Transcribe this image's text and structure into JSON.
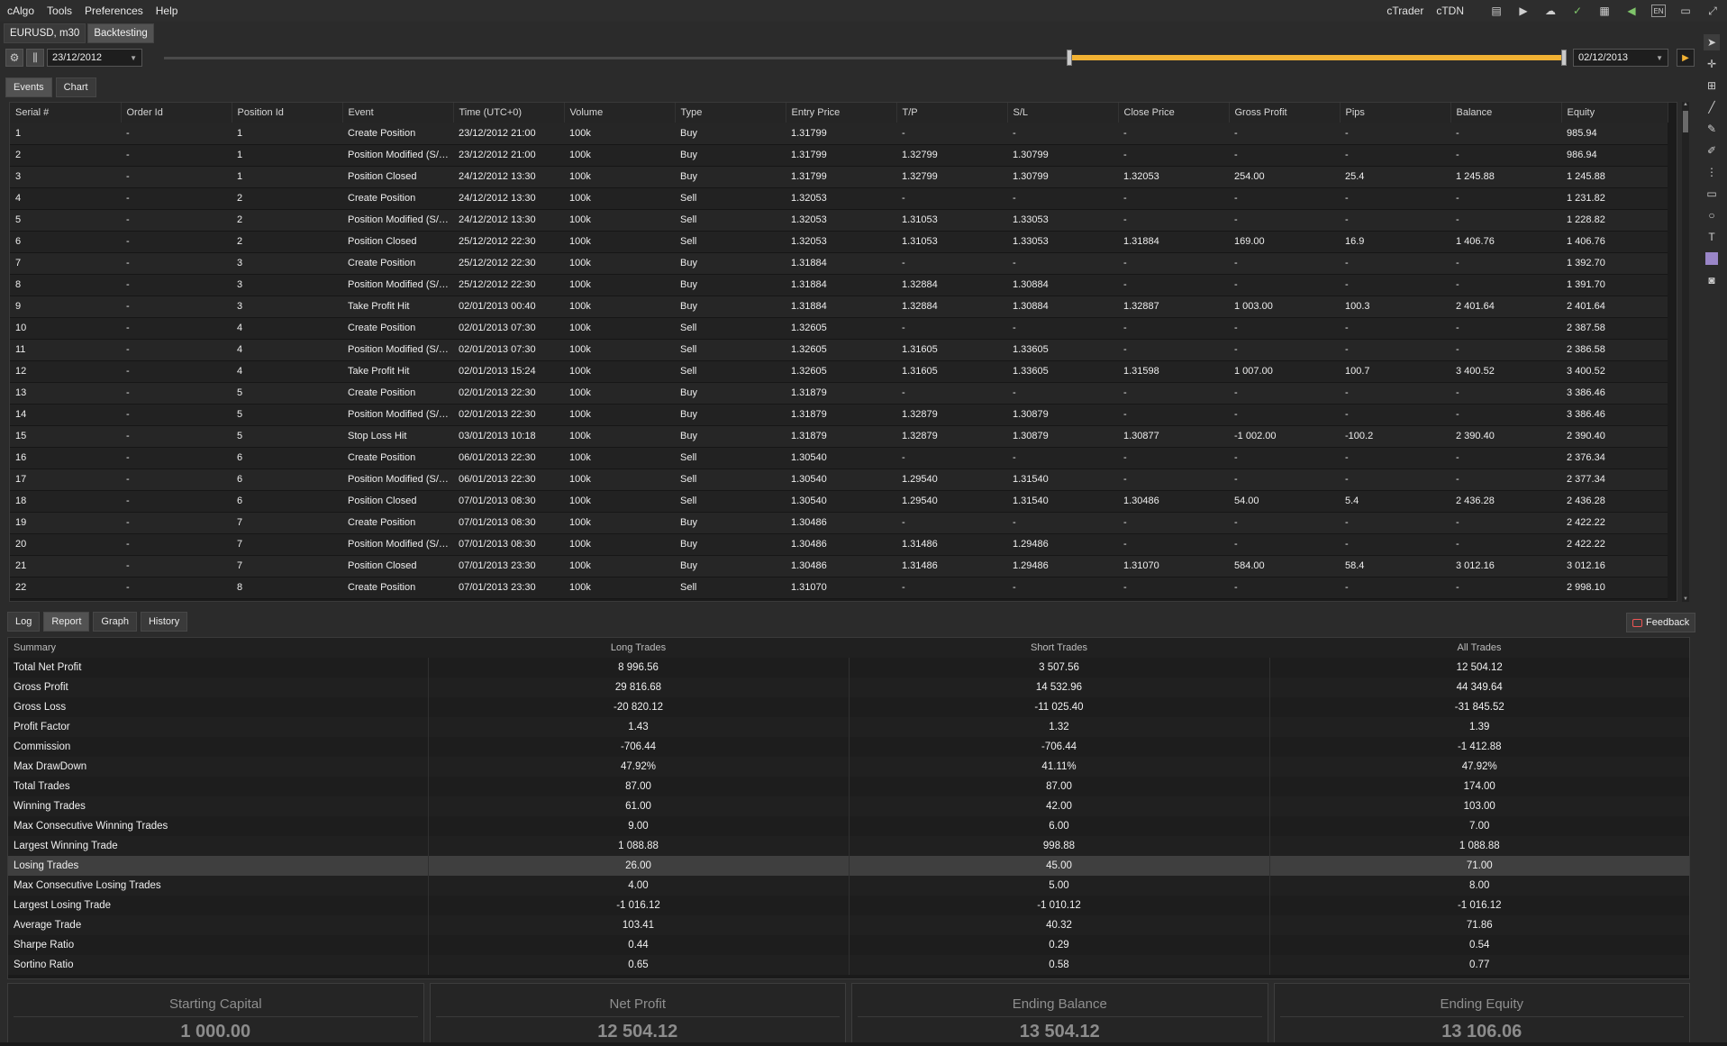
{
  "menubar": {
    "items": [
      "cAlgo",
      "Tools",
      "Preferences",
      "Help"
    ],
    "right_links": [
      "cTrader",
      "cTDN"
    ],
    "icons": [
      "notes-icon",
      "video-icon",
      "cloud-icon",
      "sync-icon",
      "calendar-icon",
      "volume-icon",
      "language-icon",
      "window-icon",
      "restore-icon"
    ],
    "lang": "EN"
  },
  "doc_tabs": [
    "EURUSD, m30",
    "Backtesting"
  ],
  "toolbar": {
    "start_date": "23/12/2012",
    "end_date": "02/12/2013",
    "period_progress": 0.35
  },
  "event_tabs": [
    "Events",
    "Chart"
  ],
  "events": {
    "columns": [
      "Serial #",
      "Order Id",
      "Position Id",
      "Event",
      "Time (UTC+0)",
      "Volume",
      "Type",
      "Entry Price",
      "T/P",
      "S/L",
      "Close Price",
      "Gross Profit",
      "Pips",
      "Balance",
      "Equity"
    ],
    "rows": [
      [
        "1",
        "-",
        "1",
        "Create Position",
        "23/12/2012 21:00",
        "100k",
        "Buy",
        "1.31799",
        "-",
        "-",
        "-",
        "-",
        "-",
        "-",
        "985.94"
      ],
      [
        "2",
        "-",
        "1",
        "Position Modified (S/L, T/P)",
        "23/12/2012 21:00",
        "100k",
        "Buy",
        "1.31799",
        "1.32799",
        "1.30799",
        "-",
        "-",
        "-",
        "-",
        "986.94"
      ],
      [
        "3",
        "-",
        "1",
        "Position Closed",
        "24/12/2012 13:30",
        "100k",
        "Buy",
        "1.31799",
        "1.32799",
        "1.30799",
        "1.32053",
        "254.00",
        "25.4",
        "1 245.88",
        "1 245.88"
      ],
      [
        "4",
        "-",
        "2",
        "Create Position",
        "24/12/2012 13:30",
        "100k",
        "Sell",
        "1.32053",
        "-",
        "-",
        "-",
        "-",
        "-",
        "-",
        "1 231.82"
      ],
      [
        "5",
        "-",
        "2",
        "Position Modified (S/L, T/P)",
        "24/12/2012 13:30",
        "100k",
        "Sell",
        "1.32053",
        "1.31053",
        "1.33053",
        "-",
        "-",
        "-",
        "-",
        "1 228.82"
      ],
      [
        "6",
        "-",
        "2",
        "Position Closed",
        "25/12/2012 22:30",
        "100k",
        "Sell",
        "1.32053",
        "1.31053",
        "1.33053",
        "1.31884",
        "169.00",
        "16.9",
        "1 406.76",
        "1 406.76"
      ],
      [
        "7",
        "-",
        "3",
        "Create Position",
        "25/12/2012 22:30",
        "100k",
        "Buy",
        "1.31884",
        "-",
        "-",
        "-",
        "-",
        "-",
        "-",
        "1 392.70"
      ],
      [
        "8",
        "-",
        "3",
        "Position Modified (S/L, T/P)",
        "25/12/2012 22:30",
        "100k",
        "Buy",
        "1.31884",
        "1.32884",
        "1.30884",
        "-",
        "-",
        "-",
        "-",
        "1 391.70"
      ],
      [
        "9",
        "-",
        "3",
        "Take Profit Hit",
        "02/01/2013 00:40",
        "100k",
        "Buy",
        "1.31884",
        "1.32884",
        "1.30884",
        "1.32887",
        "1 003.00",
        "100.3",
        "2 401.64",
        "2 401.64"
      ],
      [
        "10",
        "-",
        "4",
        "Create Position",
        "02/01/2013 07:30",
        "100k",
        "Sell",
        "1.32605",
        "-",
        "-",
        "-",
        "-",
        "-",
        "-",
        "2 387.58"
      ],
      [
        "11",
        "-",
        "4",
        "Position Modified (S/L, T/P)",
        "02/01/2013 07:30",
        "100k",
        "Sell",
        "1.32605",
        "1.31605",
        "1.33605",
        "-",
        "-",
        "-",
        "-",
        "2 386.58"
      ],
      [
        "12",
        "-",
        "4",
        "Take Profit Hit",
        "02/01/2013 15:24",
        "100k",
        "Sell",
        "1.32605",
        "1.31605",
        "1.33605",
        "1.31598",
        "1 007.00",
        "100.7",
        "3 400.52",
        "3 400.52"
      ],
      [
        "13",
        "-",
        "5",
        "Create Position",
        "02/01/2013 22:30",
        "100k",
        "Buy",
        "1.31879",
        "-",
        "-",
        "-",
        "-",
        "-",
        "-",
        "3 386.46"
      ],
      [
        "14",
        "-",
        "5",
        "Position Modified (S/L, T/P)",
        "02/01/2013 22:30",
        "100k",
        "Buy",
        "1.31879",
        "1.32879",
        "1.30879",
        "-",
        "-",
        "-",
        "-",
        "3 386.46"
      ],
      [
        "15",
        "-",
        "5",
        "Stop Loss Hit",
        "03/01/2013 10:18",
        "100k",
        "Buy",
        "1.31879",
        "1.32879",
        "1.30879",
        "1.30877",
        "-1 002.00",
        "-100.2",
        "2 390.40",
        "2 390.40"
      ],
      [
        "16",
        "-",
        "6",
        "Create Position",
        "06/01/2013 22:30",
        "100k",
        "Sell",
        "1.30540",
        "-",
        "-",
        "-",
        "-",
        "-",
        "-",
        "2 376.34"
      ],
      [
        "17",
        "-",
        "6",
        "Position Modified (S/L, T/P)",
        "06/01/2013 22:30",
        "100k",
        "Sell",
        "1.30540",
        "1.29540",
        "1.31540",
        "-",
        "-",
        "-",
        "-",
        "2 377.34"
      ],
      [
        "18",
        "-",
        "6",
        "Position Closed",
        "07/01/2013 08:30",
        "100k",
        "Sell",
        "1.30540",
        "1.29540",
        "1.31540",
        "1.30486",
        "54.00",
        "5.4",
        "2 436.28",
        "2 436.28"
      ],
      [
        "19",
        "-",
        "7",
        "Create Position",
        "07/01/2013 08:30",
        "100k",
        "Buy",
        "1.30486",
        "-",
        "-",
        "-",
        "-",
        "-",
        "-",
        "2 422.22"
      ],
      [
        "20",
        "-",
        "7",
        "Position Modified (S/L, T/P)",
        "07/01/2013 08:30",
        "100k",
        "Buy",
        "1.30486",
        "1.31486",
        "1.29486",
        "-",
        "-",
        "-",
        "-",
        "2 422.22"
      ],
      [
        "21",
        "-",
        "7",
        "Position Closed",
        "07/01/2013 23:30",
        "100k",
        "Buy",
        "1.30486",
        "1.31486",
        "1.29486",
        "1.31070",
        "584.00",
        "58.4",
        "3 012.16",
        "3 012.16"
      ],
      [
        "22",
        "-",
        "8",
        "Create Position",
        "07/01/2013 23:30",
        "100k",
        "Sell",
        "1.31070",
        "-",
        "-",
        "-",
        "-",
        "-",
        "-",
        "2 998.10"
      ]
    ]
  },
  "bottom_tabs": [
    "Log",
    "Report",
    "Graph",
    "History"
  ],
  "feedback_label": "Feedback",
  "report": {
    "columns": [
      "Summary",
      "Long Trades",
      "Short Trades",
      "All Trades"
    ],
    "rows": [
      [
        "Total Net Profit",
        "8 996.56",
        "3 507.56",
        "12 504.12"
      ],
      [
        "Gross Profit",
        "29 816.68",
        "14 532.96",
        "44 349.64"
      ],
      [
        "Gross Loss",
        "-20 820.12",
        "-11 025.40",
        "-31 845.52"
      ],
      [
        "Profit Factor",
        "1.43",
        "1.32",
        "1.39"
      ],
      [
        "Commission",
        "-706.44",
        "-706.44",
        "-1 412.88"
      ],
      [
        "Max DrawDown",
        "47.92%",
        "41.11%",
        "47.92%"
      ],
      [
        "Total Trades",
        "87.00",
        "87.00",
        "174.00"
      ],
      [
        "Winning Trades",
        "61.00",
        "42.00",
        "103.00"
      ],
      [
        "Max Consecutive Winning Trades",
        "9.00",
        "6.00",
        "7.00"
      ],
      [
        "Largest Winning Trade",
        "1 088.88",
        "998.88",
        "1 088.88"
      ],
      [
        "Losing Trades",
        "26.00",
        "45.00",
        "71.00"
      ],
      [
        "Max Consecutive Losing Trades",
        "4.00",
        "5.00",
        "8.00"
      ],
      [
        "Largest Losing Trade",
        "-1 016.12",
        "-1 010.12",
        "-1 016.12"
      ],
      [
        "Average Trade",
        "103.41",
        "40.32",
        "71.86"
      ],
      [
        "Sharpe Ratio",
        "0.44",
        "0.29",
        "0.54"
      ],
      [
        "Sortino Ratio",
        "0.65",
        "0.58",
        "0.77"
      ]
    ],
    "highlighted_row": "Losing Trades"
  },
  "cards": [
    {
      "label": "Starting Capital",
      "value": "1 000.00"
    },
    {
      "label": "Net Profit",
      "value": "12 504.12"
    },
    {
      "label": "Ending Balance",
      "value": "13 504.12"
    },
    {
      "label": "Ending Equity",
      "value": "13 106.06"
    }
  ],
  "right_tools": [
    "cursor-icon",
    "crosshair-icon",
    "zoom-icon",
    "line-icon",
    "pen-icon",
    "pencil-icon",
    "grid-icon",
    "rectangle-icon",
    "ellipse-icon",
    "text-icon",
    "color-swatch-icon",
    "camera-icon"
  ]
}
